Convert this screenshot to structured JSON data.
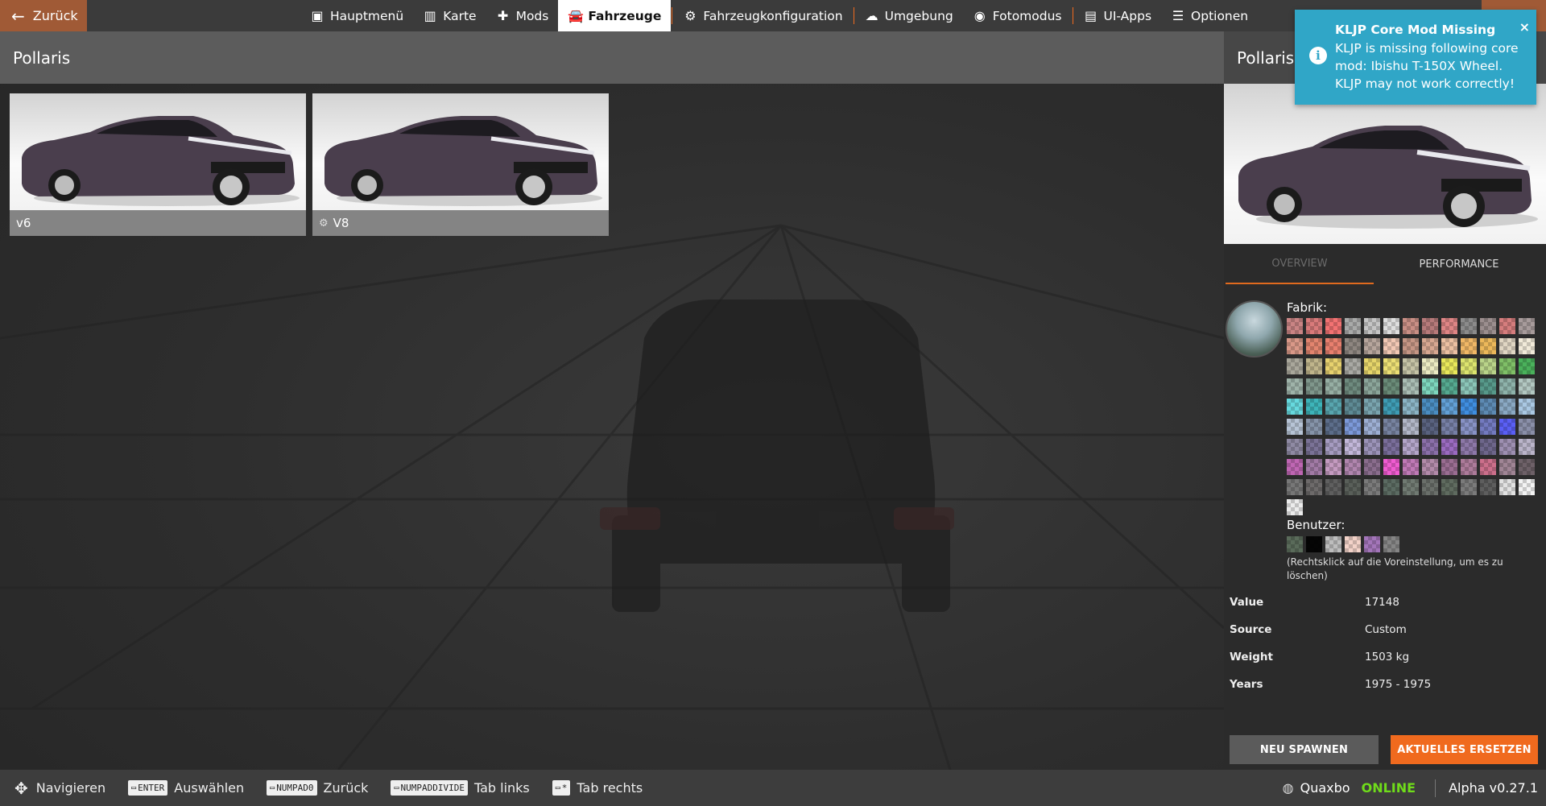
{
  "topbar": {
    "back_label": "Zurück",
    "menu": [
      {
        "label": "Hauptmenü",
        "icon": "star-square-icon",
        "glyph": "▣"
      },
      {
        "label": "Karte",
        "icon": "map-icon",
        "glyph": "▥"
      },
      {
        "label": "Mods",
        "icon": "puzzle-icon",
        "glyph": "✚"
      },
      {
        "label": "Fahrzeuge",
        "icon": "car-icon",
        "glyph": "🚘",
        "active": true
      },
      {
        "label": "Fahrzeugkonfiguration",
        "icon": "engine-icon",
        "glyph": "⚙"
      },
      {
        "label": "Umgebung",
        "icon": "weather-icon",
        "glyph": "☁"
      },
      {
        "label": "Fotomodus",
        "icon": "camera-icon",
        "glyph": "◉"
      },
      {
        "label": "UI-Apps",
        "icon": "apps-icon",
        "glyph": "▤"
      },
      {
        "label": "Optionen",
        "icon": "sliders-icon",
        "glyph": "☰"
      }
    ]
  },
  "list": {
    "title": "Pollaris",
    "configs": [
      {
        "label": "v6",
        "has_gear": false
      },
      {
        "label": "V8",
        "has_gear": true
      }
    ]
  },
  "detail": {
    "title": "Pollaris",
    "tabs": {
      "overview": "OVERVIEW",
      "performance": "PERFORMANCE"
    },
    "factory_label": "Fabrik:",
    "user_label": "Benutzer:",
    "delete_hint": "(Rechtsklick auf die Voreinstellung, um es zu löschen)",
    "info": [
      {
        "key": "Value",
        "value": "17148"
      },
      {
        "key": "Source",
        "value": "Custom"
      },
      {
        "key": "Weight",
        "value": "1503 kg"
      },
      {
        "key": "Years",
        "value": "1975 - 1975"
      }
    ],
    "respawn_label": "NEU SPAWNEN",
    "replace_label": "AKTUELLES ERSETZEN",
    "factory_colors": [
      [
        "#c98484",
        "#d87a7a",
        "#f27272",
        "#a9aaa9",
        "#c5c5c5",
        "#dedede",
        "#c98f85",
        "#b67a7a",
        "#de8585",
        "#8b8b8b",
        "#9b8e8e",
        "#d57d7d",
        "#a79b9b"
      ],
      [
        "#d99888",
        "#e2846e",
        "#e87f6e",
        "#8e8680",
        "#b6a59c",
        "#f2c8b4",
        "#c59685",
        "#d7a791",
        "#ebc0a2",
        "#f0b766",
        "#ecb85a",
        "#e0d6c3",
        "#f1ead9"
      ],
      [
        "#a9a79b",
        "#bfb48b",
        "#e7d16e",
        "#a9a9a4",
        "#e6d56a",
        "#ecdf74",
        "#c5c3a6",
        "#ebeac2",
        "#e9e85a",
        "#dce46e",
        "#b9d389",
        "#7fbf67",
        "#4ab15b"
      ],
      [
        "#9fb3a9",
        "#7f968b",
        "#96aea3",
        "#6e8a7e",
        "#8ba59a",
        "#6a8b78",
        "#aabdb4",
        "#7dd6bd",
        "#55a990",
        "#8bc5b8",
        "#57998a",
        "#8eb2aa",
        "#b2c7c1"
      ],
      [
        "#66d9de",
        "#3db4b9",
        "#58a5ae",
        "#5e8a94",
        "#79a4ae",
        "#3e9cb5",
        "#8bb4c5",
        "#4a8dc1",
        "#62a0d6",
        "#3f8ee0",
        "#5d8ab3",
        "#8aa8c3",
        "#aac8e3"
      ],
      [
        "#b7c4d6",
        "#8593a8",
        "#5c6d8a",
        "#7c99d9",
        "#9dafd3",
        "#7783a0",
        "#b2b7c7",
        "#59627f",
        "#767fa5",
        "#8892c5",
        "#737abf",
        "#5a5ff5",
        "#8a8fa8"
      ],
      [
        "#8f8aa3",
        "#7a7296",
        "#a59bc0",
        "#c2b7d9",
        "#9b93b8",
        "#7a6e9b",
        "#b3a5c9",
        "#8a6fa9",
        "#9a6ac0",
        "#8d78a8",
        "#6e668b",
        "#9d8fb1",
        "#bab4c9"
      ],
      [
        "#bf66b3",
        "#a17aa5",
        "#c49ac0",
        "#b085ae",
        "#8a6d8d",
        "#f05cd1",
        "#bf79b6",
        "#b28aa9",
        "#9a6d92",
        "#ad7b9a",
        "#cc6f8b",
        "#a08595",
        "#6e6168"
      ],
      [
        "#777",
        "#6d6a6a",
        "#5f5f5f",
        "#595f59",
        "#7a7a7a",
        "#5b6b62",
        "#707a72",
        "#6a6f6a",
        "#5f6b5f",
        "#7b7b7b",
        "#5e5e5e",
        "#e2e2e2",
        "#f3f3f3"
      ],
      [
        "#ececec"
      ]
    ],
    "user_colors": [
      "#5a6b5a",
      "#050505",
      "#bdbdbd",
      "#f2d2c8",
      "#a375b9",
      "#858585"
    ]
  },
  "toast": {
    "title": "KLJP Core Mod Missing",
    "body": "KLJP is missing following core mod: Ibishu T-150X Wheel. KLJP may not work correctly!",
    "close": "×",
    "icon": "info-icon"
  },
  "bottombar": {
    "hints": [
      {
        "key": "",
        "label": "Navigieren",
        "icon": "dpad-icon"
      },
      {
        "key": "ENTER",
        "label": "Auswählen"
      },
      {
        "key": "NUMPAD0",
        "label": "Zurück"
      },
      {
        "key": "NUMPADDIVIDE",
        "label": "Tab links"
      },
      {
        "key": "*",
        "label": "Tab rechts"
      }
    ],
    "user": "Quaxbo",
    "online": "ONLINE",
    "version": "Alpha v0.27.1"
  }
}
